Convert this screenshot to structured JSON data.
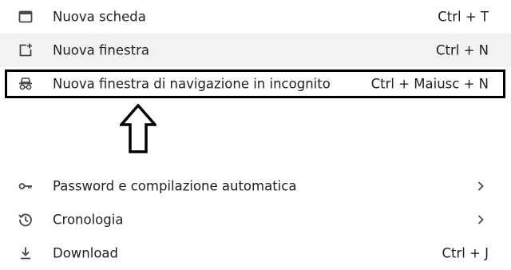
{
  "menu": {
    "items": [
      {
        "id": "new_tab",
        "label": "Nuova scheda",
        "shortcut": "Ctrl + T",
        "icon": "new-tab-icon"
      },
      {
        "id": "new_window",
        "label": "Nuova finestra",
        "shortcut": "Ctrl + N",
        "icon": "new-window-icon"
      },
      {
        "id": "incognito",
        "label": "Nuova finestra di navigazione in incognito",
        "shortcut": "Ctrl + Maiusc + N",
        "icon": "incognito-icon"
      },
      {
        "id": "passwords",
        "label": "Password e compilazione automatica",
        "shortcut": "",
        "icon": "key-icon",
        "submenu": true
      },
      {
        "id": "history",
        "label": "Cronologia",
        "shortcut": "",
        "icon": "history-icon",
        "submenu": true
      },
      {
        "id": "downloads",
        "label": "Download",
        "shortcut": "Ctrl + J",
        "icon": "download-icon"
      }
    ]
  },
  "annotation": {
    "highlight_color": "#000000",
    "arrow_icon": "up-arrow-icon"
  },
  "colors": {
    "hover_background": "#f2f2f2",
    "text": "#1f1f1f",
    "icon": "#474747"
  }
}
